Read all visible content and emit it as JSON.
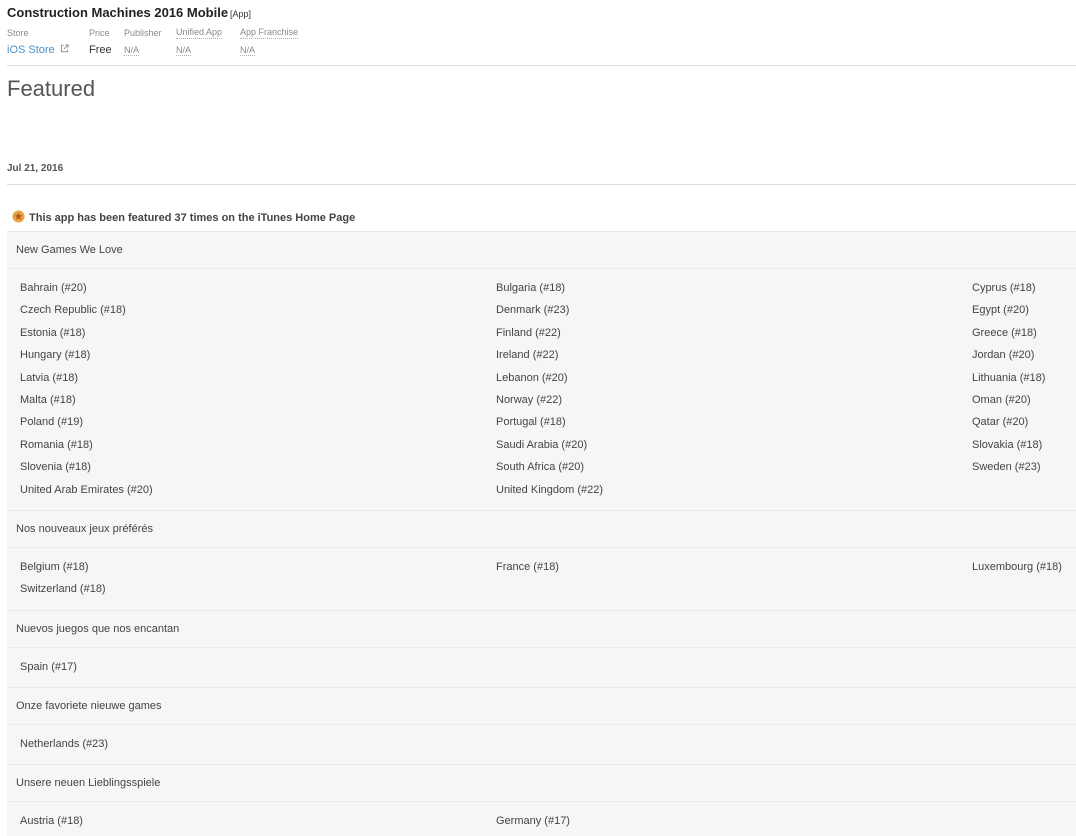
{
  "app": {
    "title": "Construction Machines 2016 Mobile",
    "tag": "[App]"
  },
  "meta": {
    "store_label": "Store",
    "store_value": "iOS Store",
    "price_label": "Price",
    "price_value": "Free",
    "publisher_label": "Publisher",
    "publisher_value": "N/A",
    "unified_label": "Unified App",
    "unified_value": "N/A",
    "franchise_label": "App Franchise",
    "franchise_value": "N/A"
  },
  "section_title": "Featured",
  "date": "Jul 21, 2016",
  "featured_summary": {
    "prefix": "This app has been featured ",
    "count": "37 times",
    "suffix": " on the iTunes Home Page"
  },
  "icons": {
    "external": "external-link-icon",
    "star": "star-badge-icon",
    "star_color": "#e8a33d"
  },
  "groups": [
    {
      "title": "New Games We Love",
      "items": [
        "Bahrain (#20)",
        "Bulgaria (#18)",
        "Cyprus (#18)",
        "Czech Republic (#18)",
        "Denmark (#23)",
        "Egypt (#20)",
        "Estonia (#18)",
        "Finland (#22)",
        "Greece (#18)",
        "Hungary (#18)",
        "Ireland (#22)",
        "Jordan (#20)",
        "Latvia (#18)",
        "Lebanon (#20)",
        "Lithuania (#18)",
        "Malta (#18)",
        "Norway (#22)",
        "Oman (#20)",
        "Poland (#19)",
        "Portugal (#18)",
        "Qatar (#20)",
        "Romania (#18)",
        "Saudi Arabia (#20)",
        "Slovakia (#18)",
        "Slovenia (#18)",
        "South Africa (#20)",
        "Sweden (#23)",
        "United Arab Emirates (#20)",
        "United Kingdom (#22)"
      ]
    },
    {
      "title": "Nos nouveaux jeux préférés",
      "items": [
        "Belgium (#18)",
        "France (#18)",
        "Luxembourg (#18)",
        "Switzerland (#18)"
      ]
    },
    {
      "title": "Nuevos juegos que nos encantan",
      "items": [
        "Spain (#17)"
      ]
    },
    {
      "title": "Onze favoriete nieuwe games",
      "items": [
        "Netherlands (#23)"
      ]
    },
    {
      "title": "Unsere neuen Lieblingsspiele",
      "items": [
        "Austria (#18)",
        "Germany (#17)"
      ]
    }
  ]
}
